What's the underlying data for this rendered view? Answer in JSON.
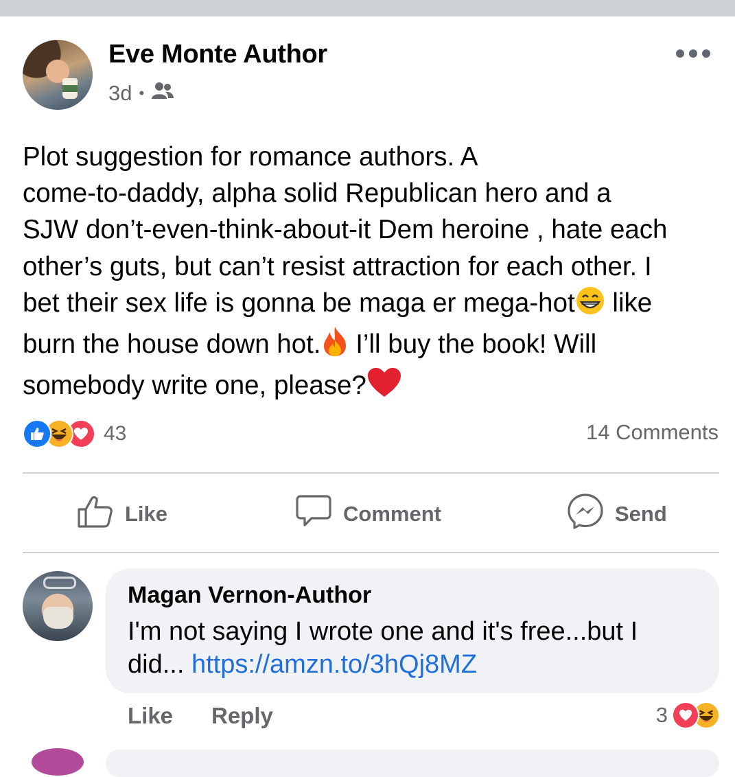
{
  "post": {
    "author": "Eve Monte Author",
    "time": "3d",
    "separator": "•",
    "audience_icon": "friends-icon",
    "body_lines": [
      "Plot suggestion for romance authors. A",
      "come-to-daddy, alpha  solid Republican hero and a",
      "SJW don’t-even-think-about-it Dem heroine , hate each",
      "other’s guts, but can’t resist attraction for each other. I",
      "bet their sex life is gonna be maga er mega-hot",
      "like",
      "burn the house down hot.",
      " I’ll buy the book! Will",
      "somebody write one, please?"
    ],
    "reaction_count": "43",
    "comment_count": "14 Comments"
  },
  "actions": {
    "like": "Like",
    "comment": "Comment",
    "send": "Send"
  },
  "comment": {
    "author": "Magan Vernon-Author",
    "text_line1": "I'm not saying I wrote one and it's free...but I",
    "text_line2_prefix": "did... ",
    "link": "https://amzn.to/3hQj8MZ",
    "like_label": "Like",
    "reply_label": "Reply",
    "reaction_count": "3"
  },
  "colors": {
    "link": "#216fdb",
    "like_blue": "#1877f2",
    "love_red": "#f33e58",
    "haha_yellow": "#f7b125",
    "secondary_text": "#65676b",
    "bubble_bg": "#f0f2f5"
  }
}
